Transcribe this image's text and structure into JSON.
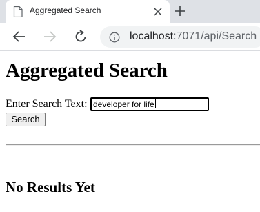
{
  "browser": {
    "tab": {
      "title": "Aggregated Search",
      "favicon": "page-icon"
    },
    "address": {
      "host": "localhost",
      "rest": ":7071/api/Search"
    }
  },
  "page": {
    "heading": "Aggregated Search",
    "search_label": "Enter Search Text:",
    "search_value": "developer for life",
    "search_button": "Search",
    "results_heading": "No Results Yet"
  }
}
